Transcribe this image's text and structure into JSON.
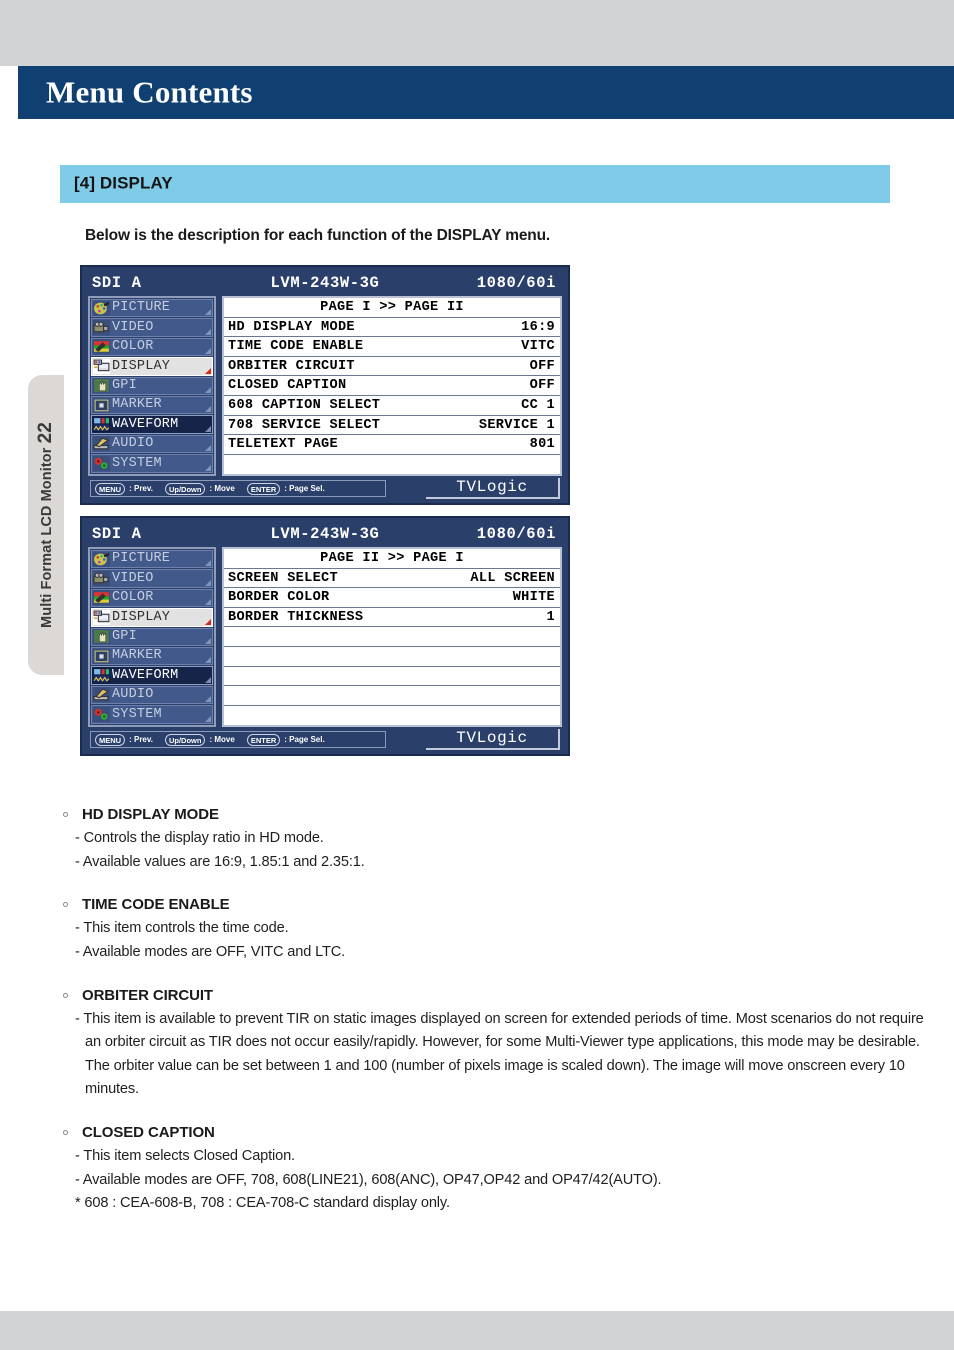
{
  "page": {
    "header_title": "Menu Contents",
    "side_tab_text": "Multi Format LCD Monitor",
    "page_number": "22",
    "section_label": "[4] DISPLAY",
    "intro": "Below is the description for each function of the DISPLAY menu."
  },
  "osd_common": {
    "input_label": "SDI A",
    "model": "LVM-243W-3G",
    "format": "1080/60i",
    "brand": "TVLogic",
    "menu_items": [
      {
        "label": "PICTURE",
        "icon": "palette-icon",
        "state": "normal"
      },
      {
        "label": "VIDEO",
        "icon": "camcorder-icon",
        "state": "normal"
      },
      {
        "label": "COLOR",
        "icon": "colorbar-icon",
        "state": "normal"
      },
      {
        "label": "DISPLAY",
        "icon": "monitor-icon",
        "state": "selected-light"
      },
      {
        "label": "GPI",
        "icon": "hand-icon",
        "state": "normal"
      },
      {
        "label": "MARKER",
        "icon": "marker-icon",
        "state": "normal"
      },
      {
        "label": "WAVEFORM",
        "icon": "waveform-icon",
        "state": "selected-dark"
      },
      {
        "label": "AUDIO",
        "icon": "speaker-icon",
        "state": "normal"
      },
      {
        "label": "SYSTEM",
        "icon": "gears-icon",
        "state": "normal"
      }
    ],
    "hints": [
      {
        "key": "MENU",
        "desc": ": Prev."
      },
      {
        "key": "Up/Down",
        "desc": ": Move"
      },
      {
        "key": "ENTER",
        "desc": ": Page Sel."
      }
    ]
  },
  "osd_page_1": {
    "page_header": "PAGE I >> PAGE II",
    "rows": [
      {
        "name": "HD DISPLAY MODE",
        "value": "16:9"
      },
      {
        "name": "TIME CODE ENABLE",
        "value": "VITC"
      },
      {
        "name": "ORBITER CIRCUIT",
        "value": "OFF"
      },
      {
        "name": "CLOSED CAPTION",
        "value": "OFF"
      },
      {
        "name": "608 CAPTION SELECT",
        "value": "CC 1"
      },
      {
        "name": "708 SERVICE SELECT",
        "value": "SERVICE 1"
      },
      {
        "name": "TELETEXT PAGE",
        "value": "801"
      },
      {
        "name": "",
        "value": ""
      }
    ]
  },
  "osd_page_2": {
    "page_header": "PAGE II >> PAGE I",
    "rows": [
      {
        "name": "SCREEN SELECT",
        "value": "ALL SCREEN"
      },
      {
        "name": "BORDER COLOR",
        "value": "WHITE"
      },
      {
        "name": "BORDER THICKNESS",
        "value": "1"
      },
      {
        "name": "",
        "value": ""
      },
      {
        "name": "",
        "value": ""
      },
      {
        "name": "",
        "value": ""
      },
      {
        "name": "",
        "value": ""
      },
      {
        "name": "",
        "value": ""
      }
    ]
  },
  "descriptions": [
    {
      "title": "HD DISPLAY MODE",
      "lines": [
        "- Controls the display ratio in HD mode.",
        "- Available values are 16:9, 1.85:1 and 2.35:1."
      ]
    },
    {
      "title": "TIME CODE ENABLE",
      "lines": [
        "- This item controls the time code.",
        "- Available modes are OFF, VITC and LTC."
      ]
    },
    {
      "title": "ORBITER CIRCUIT",
      "lines": [
        "- This item is available to prevent TIR on static images displayed on screen for extended periods of time. Most scenarios do not require an orbiter circuit as TIR does not occur easily/rapidly. However, for some Multi-Viewer type applications, this mode may be desirable. The orbiter value can be set between 1 and 100 (number of pixels image is scaled down). The image will move onscreen every 10 minutes."
      ]
    },
    {
      "title": "CLOSED CAPTION",
      "lines": [
        "- This item selects Closed Caption.",
        "- Available modes are OFF, 708, 608(LINE21), 608(ANC), OP47,OP42 and OP47/42(AUTO).",
        "* 608 : CEA-608-B, 708 : CEA-708-C standard display only."
      ]
    }
  ],
  "colors": {
    "header_blue": "#104072",
    "section_blue": "#80cbe8",
    "osd_navy": "#2b3f6b",
    "page_gray": "#d2d3d5",
    "marker_red": "#d42b1c"
  }
}
